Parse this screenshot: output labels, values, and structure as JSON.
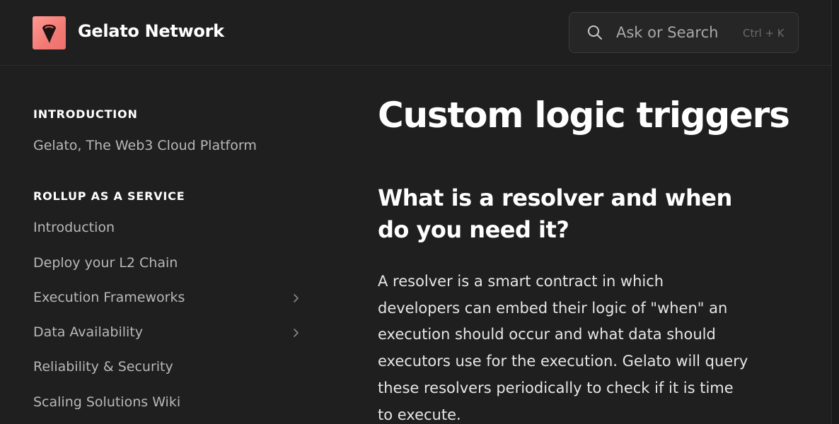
{
  "header": {
    "brand": "Gelato Network",
    "search_placeholder": "Ask or Search",
    "search_shortcut": "Ctrl + K"
  },
  "sidebar": {
    "sections": [
      {
        "title": "INTRODUCTION",
        "items": [
          {
            "label": "Gelato, The Web3 Cloud Platform",
            "expandable": false
          }
        ]
      },
      {
        "title": "ROLLUP AS A SERVICE",
        "items": [
          {
            "label": "Introduction",
            "expandable": false
          },
          {
            "label": "Deploy your L2 Chain",
            "expandable": false
          },
          {
            "label": "Execution Frameworks",
            "expandable": true
          },
          {
            "label": "Data Availability",
            "expandable": true
          },
          {
            "label": "Reliability & Security",
            "expandable": false
          },
          {
            "label": "Scaling Solutions Wiki",
            "expandable": false
          }
        ]
      }
    ]
  },
  "content": {
    "title": "Custom logic triggers",
    "subheading": "What is a resolver and when do you need it?",
    "paragraph": "A resolver is a smart contract in which developers can embed their logic of \"when\" an execution should occur and what data should executors use for the execution. Gelato will query these resolvers periodically to check if it is time to execute."
  },
  "icons": {
    "logo": "gelato-logo-icon",
    "search": "search-icon",
    "chevron": "chevron-right-icon"
  },
  "colors": {
    "background": "#1f1f1f",
    "logo_tile": "#f27a74",
    "text_primary": "#ffffff",
    "text_secondary": "#b8b8b8"
  }
}
